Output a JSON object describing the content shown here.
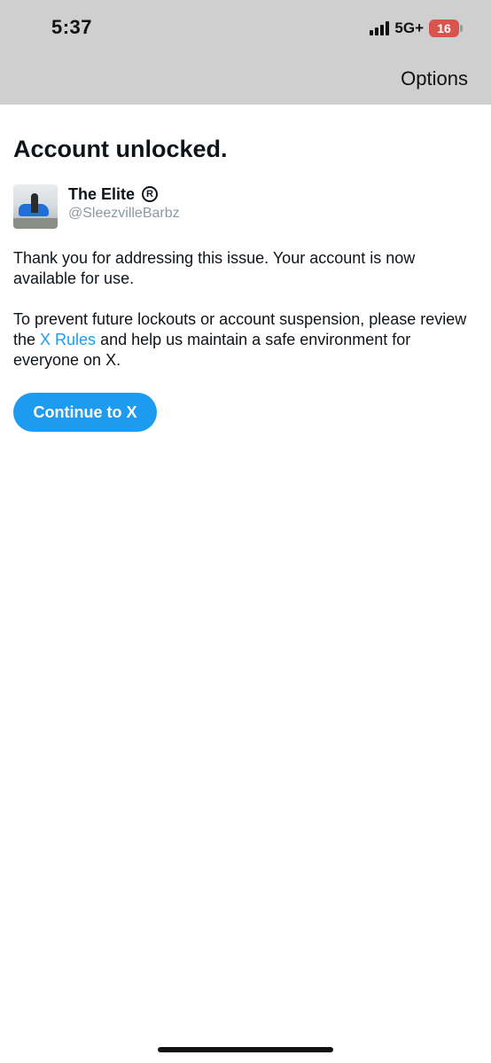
{
  "status_bar": {
    "time": "5:37",
    "network": "5G+",
    "battery_level": "16",
    "battery_color": "#d9534f"
  },
  "nav": {
    "options_label": "Options"
  },
  "main": {
    "title": "Account unlocked.",
    "account": {
      "name": "The Elite",
      "registered_symbol": "R",
      "handle": "@SleezvilleBarbz"
    },
    "paragraph1": "Thank you for addressing this issue. Your account is now available for use.",
    "paragraph2_before": "To prevent future lockouts or account suspension, please review the ",
    "paragraph2_link": "X Rules",
    "paragraph2_after": " and help us maintain a safe environment for everyone on X.",
    "continue_button": "Continue to X"
  },
  "colors": {
    "accent": "#1d9bf0",
    "topbar": "#cfcfcf",
    "text": "#0f1419",
    "muted": "#8b98a5"
  },
  "icons": {
    "signal": "signal-bars-icon",
    "registered": "registered-trademark-icon"
  }
}
